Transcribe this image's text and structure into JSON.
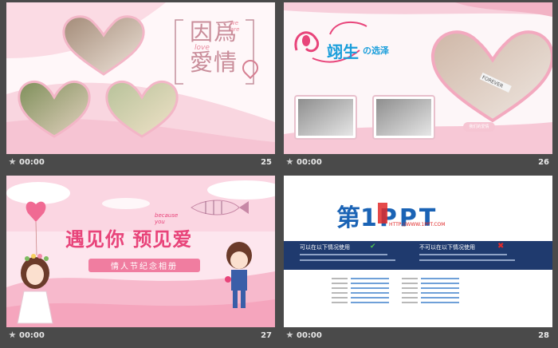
{
  "slides": [
    {
      "time": "00:00",
      "number": "25",
      "title_glyphs": "因爲愛情",
      "love_text": "love",
      "we_are": "we are",
      "you_text": "you"
    },
    {
      "time": "00:00",
      "number": "26",
      "title_main": "翊生",
      "title_sub": "の选泽",
      "heart_caption": "我们的爱情",
      "card_letters": "FOREVER"
    },
    {
      "time": "00:00",
      "number": "27",
      "title_main": "遇见你 预见爱",
      "because": "because you",
      "subtitle": "情人节纪念相册"
    },
    {
      "time": "00:00",
      "number": "28",
      "logo_char": "第",
      "logo_rest": "1PPT",
      "url": "HTTP://WWW.1PPT.COM",
      "can_use": "可以在以下情况使用",
      "cannot_use": "不可以在以下情况使用"
    }
  ],
  "colors": {
    "pink": "#e8447a",
    "light_pink": "#f8c9d6",
    "navy": "#1f3a6e",
    "logo_blue": "#1a63b5",
    "logo_red": "#e02a2a"
  }
}
